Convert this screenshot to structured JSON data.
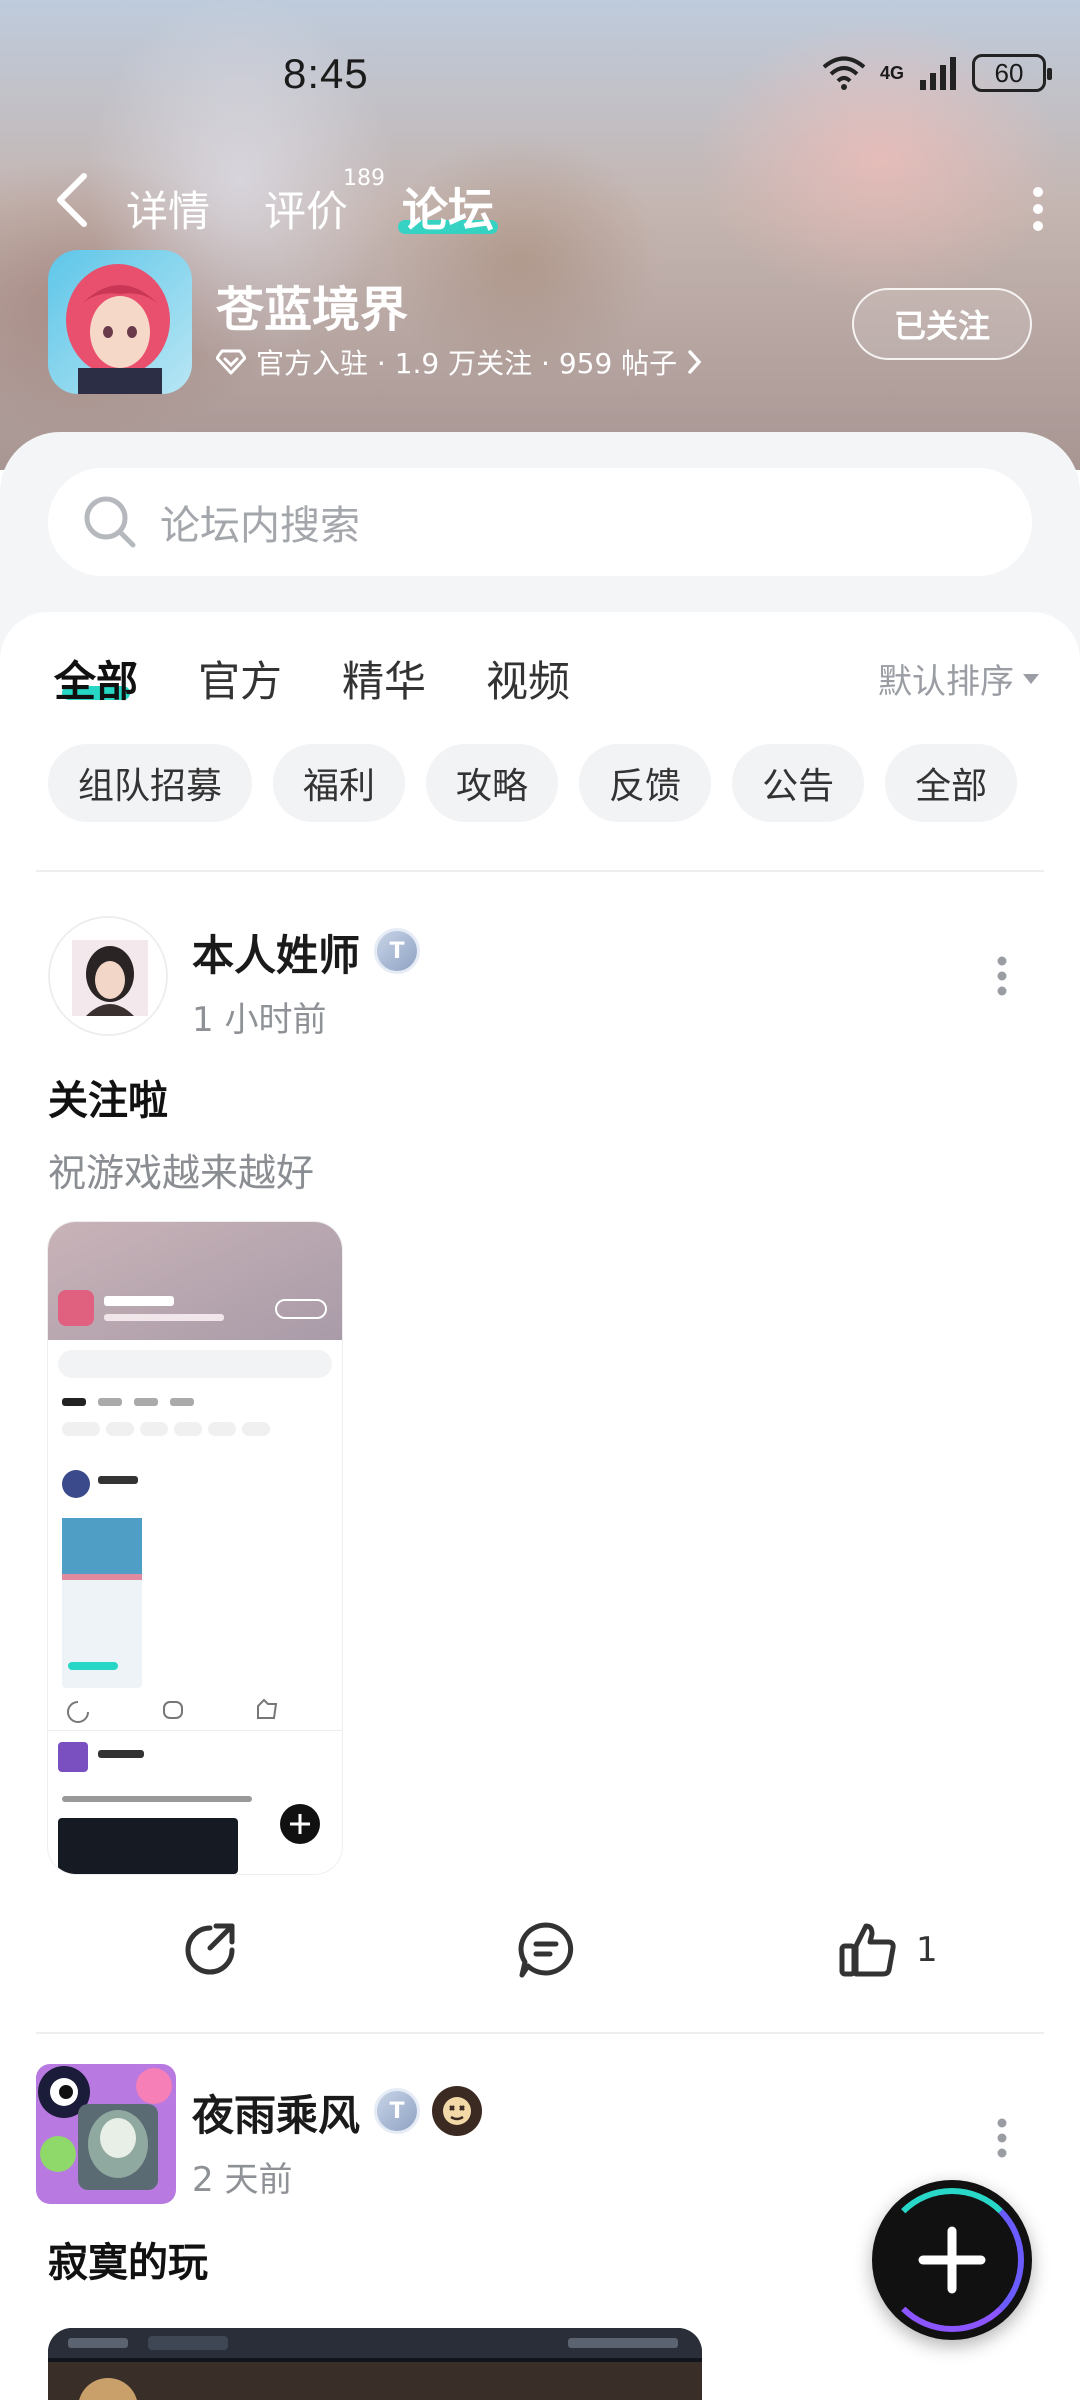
{
  "status_bar": {
    "time": "8:45",
    "network": "4G",
    "battery": "60"
  },
  "nav": {
    "tabs": [
      {
        "label": "详情"
      },
      {
        "label": "评价",
        "badge": "189"
      },
      {
        "label": "论坛"
      }
    ],
    "active_tab": "论坛"
  },
  "game": {
    "name": "苍蓝境界",
    "meta": "官方入驻 · 1.9 万关注 · 959 帖子",
    "follow_label": "已关注"
  },
  "search": {
    "placeholder": "论坛内搜索"
  },
  "filter_tabs": [
    "全部",
    "官方",
    "精华",
    "视频"
  ],
  "sort_label": "默认排序",
  "chips": [
    "组队招募",
    "福利",
    "攻略",
    "反馈",
    "公告",
    "全部"
  ],
  "posts": [
    {
      "author": "本人姓师",
      "time": "1 小时前",
      "title": "关注啦",
      "body": "祝游戏越来越好",
      "like_count": "1"
    },
    {
      "author": "夜雨乘风",
      "time": "2 天前",
      "title": "寂寞的玩"
    }
  ],
  "colors": {
    "accent": "#27d7c6",
    "text": "#1a1a1a",
    "muted": "#8e9196"
  }
}
